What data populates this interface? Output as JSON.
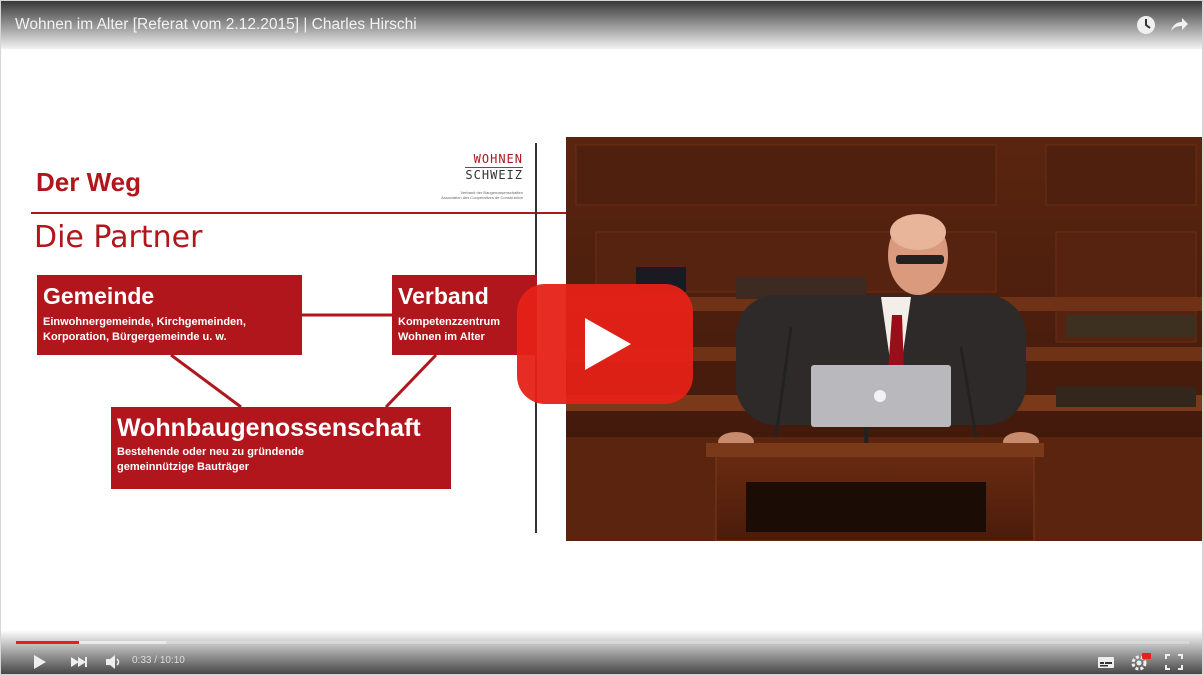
{
  "player": {
    "title": "Wohnen im Alter [Referat vom 2.12.2015] | Charles Hirschi",
    "time_current": "0:33",
    "time_separator": " / ",
    "time_duration": "10:10",
    "progress_played": 0.054,
    "progress_loaded": 0.128,
    "accent_color": "#e62117"
  },
  "slide": {
    "heading": "Der Weg",
    "subheading": "Die Partner",
    "logo": {
      "line1": "WOHNEN",
      "line2": "SCHWEIZ",
      "tag1": "Verband der Baugenossenschaften",
      "tag2": "Association des Coopératives de Construction"
    },
    "boxes": [
      {
        "title": "Gemeinde",
        "desc1": "Einwohnergemeinde, Kirchgemeinden,",
        "desc2": "Korporation, Bürgergemeinde u. w."
      },
      {
        "title": "Verband",
        "desc1": "Kompetenzzentrum",
        "desc2": "Wohnen im Alter"
      },
      {
        "title": "Wohnbaugenossenschaft",
        "desc1": "Bestehende oder neu zu gründende",
        "desc2": "gemeinnützige Bauträger"
      }
    ],
    "brand_color": "#b0161c"
  },
  "icons": {
    "watch_later": "clock-icon",
    "share": "share-arrow-icon",
    "play": "play-icon",
    "next": "next-icon",
    "volume": "volume-icon",
    "subtitles": "subtitles-icon",
    "settings": "gear-icon",
    "fullscreen": "fullscreen-icon",
    "big_play": "youtube-play-icon"
  }
}
